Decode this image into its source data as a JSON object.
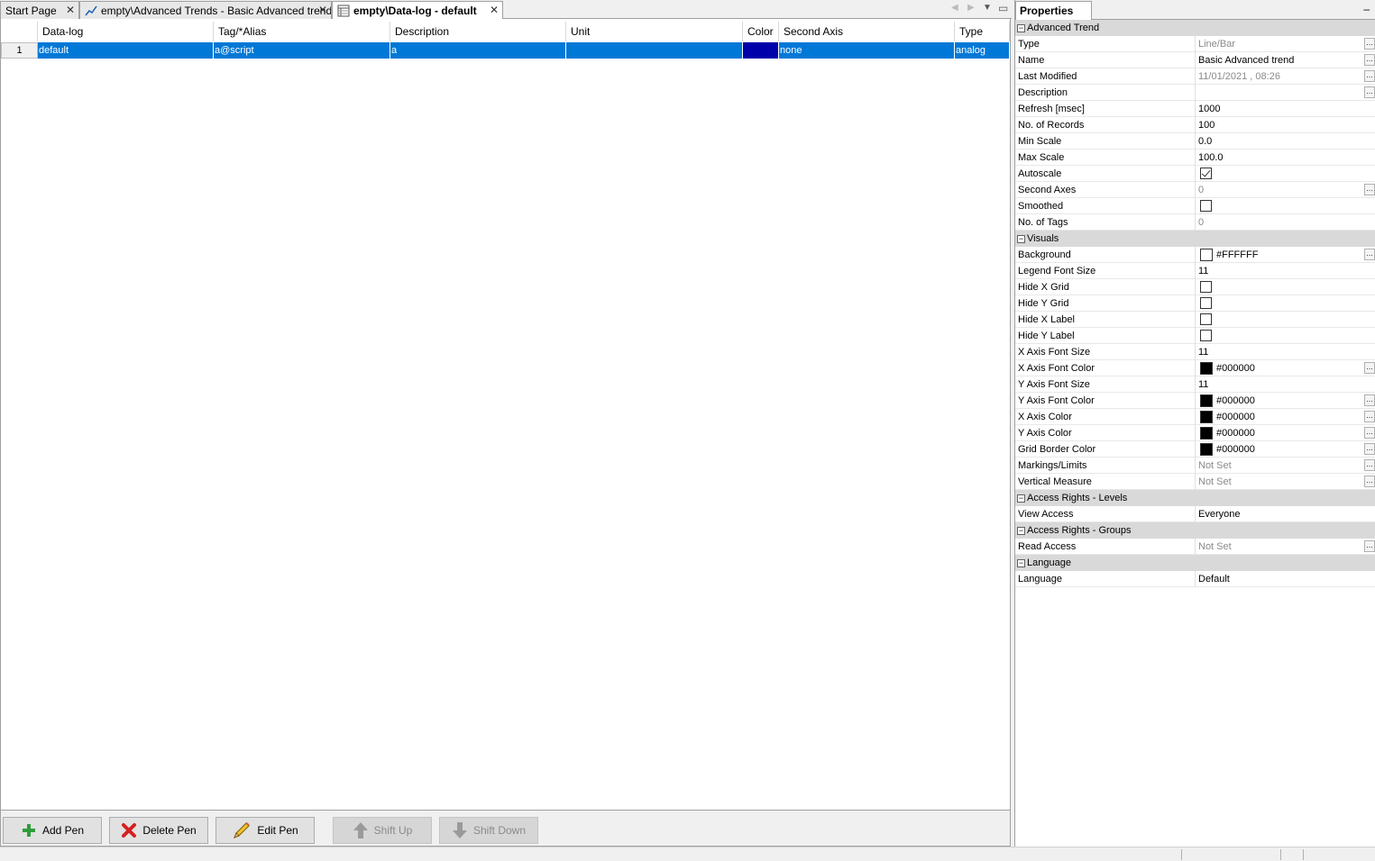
{
  "tabs": [
    {
      "label": "Start Page",
      "close": "✕",
      "icon": "none"
    },
    {
      "label": "empty\\Advanced Trends - Basic Advanced trend",
      "close": "✕",
      "icon": "trend-chart-icon"
    },
    {
      "label": "empty\\Data-log - default",
      "close": "✕",
      "icon": "datalog-table-icon",
      "active": true
    }
  ],
  "grid": {
    "columns": [
      "Data-log",
      "Tag/*Alias",
      "Description",
      "Unit",
      "Color",
      "Second Axis",
      "Type"
    ],
    "rows": [
      {
        "num": "1",
        "datalog": "default",
        "tag": "a@script",
        "description": "a",
        "unit": "",
        "color": "#0000aa",
        "second_axis": "none",
        "type": "analog"
      }
    ]
  },
  "toolbar": {
    "add_pen": "Add Pen",
    "delete_pen": "Delete Pen",
    "edit_pen": "Edit Pen",
    "shift_up": "Shift Up",
    "shift_down": "Shift Down"
  },
  "properties": {
    "title": "Properties",
    "minimize": "–",
    "categories": {
      "advanced_trend": "Advanced Trend",
      "visuals": "Visuals",
      "access_levels": "Access Rights - Levels",
      "access_groups": "Access Rights - Groups",
      "language": "Language"
    },
    "advanced_trend": {
      "type_label": "Type",
      "type_value": "Line/Bar",
      "name_label": "Name",
      "name_value": "Basic Advanced trend",
      "modified_label": "Last Modified",
      "modified_value": "11/01/2021 , 08:26",
      "description_label": "Description",
      "description_value": "",
      "refresh_label": "Refresh [msec]",
      "refresh_value": "1000",
      "records_label": "No. of Records",
      "records_value": "100",
      "min_label": "Min Scale",
      "min_value": "0.0",
      "max_label": "Max Scale",
      "max_value": "100.0",
      "autoscale_label": "Autoscale",
      "second_axes_label": "Second Axes",
      "second_axes_value": "0",
      "smoothed_label": "Smoothed",
      "tags_label": "No. of Tags",
      "tags_value": "0"
    },
    "visuals": {
      "background_label": "Background",
      "background_value": "#FFFFFF",
      "legend_font_label": "Legend Font Size",
      "legend_font_value": "11",
      "hide_x_grid_label": "Hide X Grid",
      "hide_y_grid_label": "Hide Y Grid",
      "hide_x_label_label": "Hide X Label",
      "hide_y_label_label": "Hide Y Label",
      "x_font_size_label": "X Axis Font Size",
      "x_font_size_value": "11",
      "x_font_color_label": "X Axis Font Color",
      "x_font_color_value": "#000000",
      "y_font_size_label": "Y Axis Font Size",
      "y_font_size_value": "11",
      "y_font_color_label": "Y Axis Font Color",
      "y_font_color_value": "#000000",
      "x_color_label": "X Axis Color",
      "x_color_value": "#000000",
      "y_color_label": "Y Axis Color",
      "y_color_value": "#000000",
      "grid_border_label": "Grid Border Color",
      "grid_border_value": "#000000",
      "markings_label": "Markings/Limits",
      "markings_value": "Not Set",
      "vertical_label": "Vertical Measure",
      "vertical_value": "Not Set"
    },
    "access_levels": {
      "view_label": "View Access",
      "view_value": "Everyone"
    },
    "access_groups": {
      "read_label": "Read Access",
      "read_value": "Not Set"
    },
    "language": {
      "language_label": "Language",
      "language_value": "Default"
    },
    "ellipsis": "..."
  },
  "colors": {
    "selection": "#0078d7",
    "pen_color": "#0000aa",
    "category_bg": "#d9d9d9"
  }
}
